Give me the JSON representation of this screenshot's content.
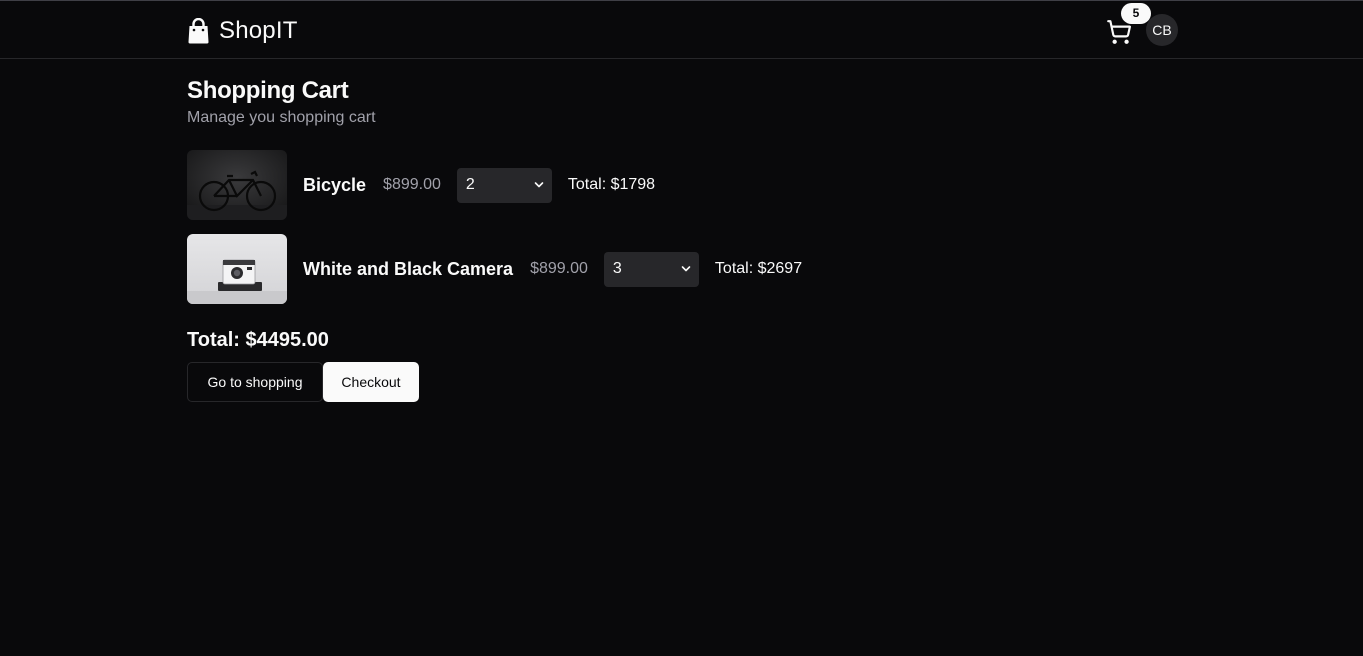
{
  "header": {
    "brand": "ShopIT",
    "cart_count": "5",
    "avatar_initials": "CB"
  },
  "main": {
    "title": "Shopping Cart",
    "subtitle": "Manage you shopping cart",
    "items": [
      {
        "name": "Bicycle",
        "price": "$899.00",
        "quantity": "2",
        "total": "Total: $1798"
      },
      {
        "name": "White and Black Camera",
        "price": "$899.00",
        "quantity": "3",
        "total": "Total: $2697"
      }
    ],
    "grand_total": "Total: $4495.00",
    "buttons": {
      "shopping": "Go to shopping",
      "checkout": "Checkout"
    }
  },
  "icons": {
    "brand": "shopping-bag-icon",
    "cart": "shopping-cart-icon",
    "select": "chevron-down-icon"
  },
  "colors": {
    "background": "#09090b",
    "foreground": "#fafafa",
    "muted": "#a1a1aa",
    "input": "#27272a"
  }
}
